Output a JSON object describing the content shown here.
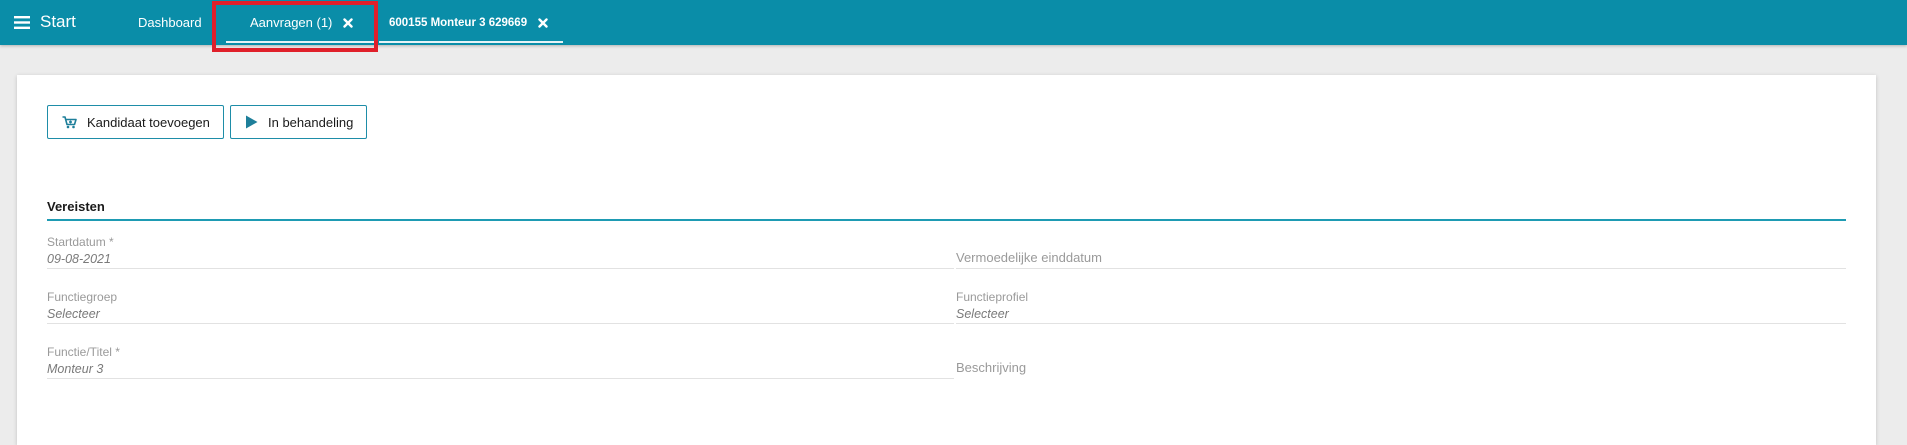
{
  "topbar": {
    "menu_label": "Start",
    "menu_icon": "hamburger-icon",
    "tabs": [
      {
        "label": "Dashboard"
      },
      {
        "label": "Aanvragen (1)",
        "close_icon": "close-icon"
      },
      {
        "label": "600155 Monteur 3 629669",
        "close_icon": "close-icon"
      }
    ],
    "color": "#0a8da8"
  },
  "toolbar": {
    "add_candidate_label": "Kandidaat toevoegen",
    "add_candidate_icon": "cart-add-icon",
    "in_progress_label": "In behandeling",
    "in_progress_icon": "play-icon"
  },
  "section": {
    "title": "Vereisten",
    "fields": {
      "startdatum": {
        "label": "Startdatum *",
        "value": "09-08-2021"
      },
      "einddatum": {
        "label": "Vermoedelijke einddatum",
        "value": ""
      },
      "functiegroep": {
        "label": "Functiegroep",
        "placeholder": "Selecteer"
      },
      "functieprofiel": {
        "label": "Functieprofiel",
        "placeholder": "Selecteer"
      },
      "functietitel": {
        "label": "Functie/Titel *",
        "value": "Monteur 3"
      },
      "beschrijving": {
        "label": "Beschrijving",
        "value": ""
      }
    }
  },
  "accent_color": "#1e9bb3",
  "highlight_color": "#e0202a"
}
